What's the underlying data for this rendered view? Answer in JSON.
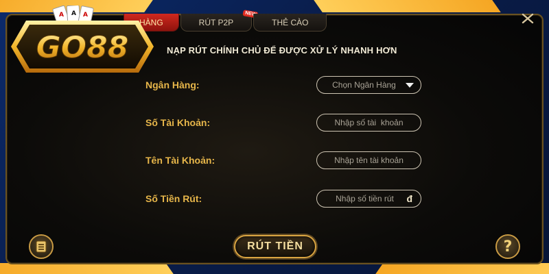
{
  "logo": {
    "text": "GO88"
  },
  "tabs": [
    {
      "label": "HÀNG",
      "active": true
    },
    {
      "label": "RÚT P2P",
      "active": false,
      "badge": "NEW"
    },
    {
      "label": "THẺ CÀO",
      "active": false
    }
  ],
  "header": {
    "title": "NẠP RÚT CHÍNH CHỦ ĐỂ ĐƯỢC XỬ LÝ NHANH HƠN"
  },
  "form": {
    "bank": {
      "label": "Ngân Hàng:",
      "placeholder": "Chọn Ngân Hàng"
    },
    "account_number": {
      "label": "Số Tài Khoản:",
      "placeholder": "Nhập số tài  khoản"
    },
    "account_name": {
      "label": "Tên Tài Khoản:",
      "placeholder": "Nhập tên tài khoản"
    },
    "amount": {
      "label": "Số Tiền Rút:",
      "placeholder": "Nhập số tiền rút",
      "currency": "đ"
    }
  },
  "buttons": {
    "withdraw": "RÚT TIỀN",
    "help": "?"
  },
  "colors": {
    "accent_gold": "#e7b64a",
    "tab_active": "#c8241b",
    "frame_blue": "#0b2a6b",
    "stripe_gold": "#f5a623"
  },
  "icons": {
    "close": "close-icon",
    "history": "document-list-icon",
    "help": "question-icon"
  }
}
